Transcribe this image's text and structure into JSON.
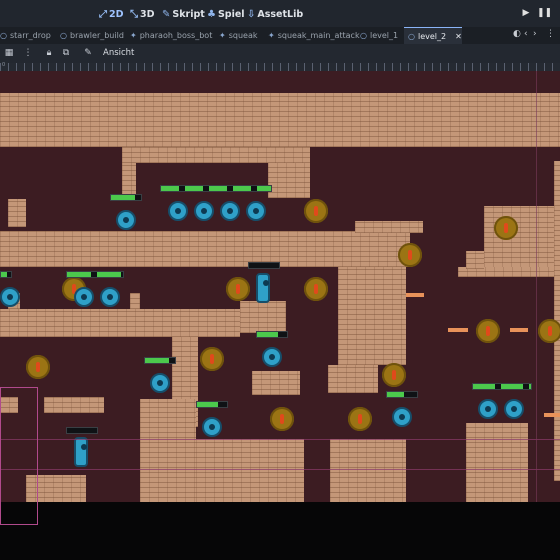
{
  "workspaces": [
    {
      "icon": "2d-icon",
      "label": "2D",
      "active": true
    },
    {
      "icon": "3d-icon",
      "label": "3D",
      "active": false
    },
    {
      "icon": "script-icon",
      "label": "Skript",
      "active": false
    },
    {
      "icon": "game-icon",
      "label": "Spiel",
      "active": false
    },
    {
      "icon": "assetlib-icon",
      "label": "AssetLib",
      "active": false
    }
  ],
  "scene_tabs": [
    {
      "label": "starr_drop"
    },
    {
      "label": "brawler_build"
    },
    {
      "label": "pharaoh_boss_bot"
    },
    {
      "label": "squeak"
    },
    {
      "label": "squeak_main_attack"
    },
    {
      "label": "level_1"
    },
    {
      "label": "level_2",
      "active": true
    }
  ],
  "toolbar": {
    "view_menu": "Ansicht"
  },
  "ruler_labels": [
    "0",
    "",
    "",
    "",
    "",
    "",
    "",
    ""
  ],
  "colors": {
    "background": "#3c1c22",
    "wall": "#c49778",
    "enemy": "#2fa0c8",
    "gold_token": "#9b7414",
    "health": "#4cc94c",
    "accent": "#8ab4f8"
  }
}
